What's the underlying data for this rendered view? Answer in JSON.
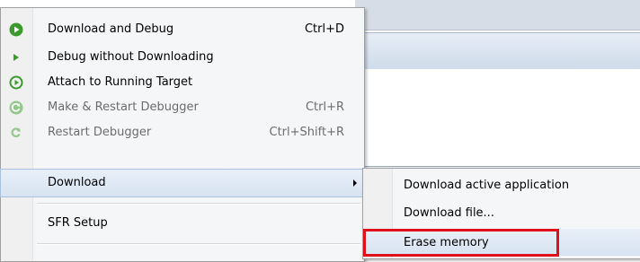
{
  "menu": {
    "items": [
      {
        "label": "Download and Debug",
        "shortcut": "Ctrl+D",
        "icon": "download-debug-icon",
        "enabled": true
      },
      {
        "label": "Debug without Downloading",
        "shortcut": "",
        "icon": "debug-play-icon",
        "enabled": true
      },
      {
        "label": "Attach to Running Target",
        "shortcut": "",
        "icon": "attach-target-icon",
        "enabled": true
      },
      {
        "label": "Make & Restart Debugger",
        "shortcut": "Ctrl+R",
        "icon": "make-restart-icon",
        "enabled": false
      },
      {
        "label": "Restart Debugger",
        "shortcut": "Ctrl+Shift+R",
        "icon": "restart-icon",
        "enabled": false
      },
      {
        "label": "Download",
        "shortcut": "",
        "icon": "",
        "enabled": true,
        "submenu": true,
        "highlighted": true
      },
      {
        "label": "SFR Setup",
        "shortcut": "",
        "icon": "",
        "enabled": true
      }
    ]
  },
  "submenu": {
    "items": [
      {
        "label": "Download active application"
      },
      {
        "label": "Download file..."
      },
      {
        "label": "Erase memory",
        "highlighted": true,
        "annotated": true
      }
    ]
  },
  "colors": {
    "icon_green": "#3a9b2c",
    "icon_green_disabled": "#94c78c",
    "annotation_red": "#e0101b",
    "highlight": "#d7e3f1"
  }
}
